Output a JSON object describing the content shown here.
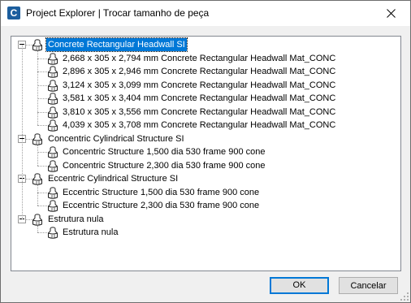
{
  "window": {
    "title": "Project Explorer | Trocar tamanho de peça",
    "app_icon": "civil-3d-icon",
    "close_icon": "close-icon"
  },
  "tree": {
    "groups": [
      {
        "label": "Concrete Rectangular Headwall SI",
        "selected": true,
        "children": [
          "2,668 x 305 x 2,794 mm Concrete Rectangular Headwall Mat_CONC",
          "2,896 x 305 x 2,946 mm Concrete Rectangular Headwall Mat_CONC",
          "3,124 x 305 x 3,099 mm Concrete Rectangular Headwall Mat_CONC",
          "3,581 x 305 x 3,404 mm Concrete Rectangular Headwall Mat_CONC",
          "3,810 x 305 x 3,556 mm Concrete Rectangular Headwall Mat_CONC",
          "4,039 x 305 x 3,708 mm Concrete Rectangular Headwall Mat_CONC"
        ]
      },
      {
        "label": "Concentric Cylindrical Structure SI",
        "selected": false,
        "children": [
          "Concentric Structure 1,500 dia 530 frame 900 cone",
          "Concentric Structure 2,300 dia 530 frame 900 cone"
        ]
      },
      {
        "label": "Eccentric Cylindrical Structure SI",
        "selected": false,
        "children": [
          "Eccentric Structure 1,500 dia 530 frame 900 cone",
          "Eccentric Structure 2,300 dia 530 frame 900 cone"
        ]
      },
      {
        "label": "Estrutura nula",
        "selected": false,
        "children": [
          "Estrutura nula"
        ]
      }
    ]
  },
  "buttons": {
    "ok_label": "OK",
    "cancel_label": "Cancelar"
  },
  "colors": {
    "selection": "#0078d7",
    "default_button_border": "#0078d7"
  }
}
